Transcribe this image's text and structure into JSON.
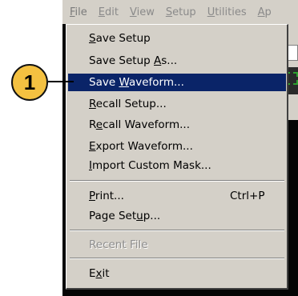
{
  "menubar": {
    "items": [
      {
        "label": "File",
        "mnemonic": "F",
        "rest": "ile"
      },
      {
        "label": "Edit",
        "mnemonic": "E",
        "rest": "dit"
      },
      {
        "label": "View",
        "mnemonic": "V",
        "rest": "iew"
      },
      {
        "label": "Setup",
        "mnemonic": "S",
        "rest": "etup"
      },
      {
        "label": "Utilities",
        "mnemonic": "U",
        "rest": "tilities"
      },
      {
        "label": "Ap",
        "mnemonic": "A",
        "rest": "p"
      }
    ]
  },
  "behind": {
    "box_char": "p"
  },
  "file_menu": {
    "items": [
      {
        "pre": "",
        "mn": "S",
        "post": "ave Setup"
      },
      {
        "pre": "Save Setup ",
        "mn": "A",
        "post": "s..."
      },
      {
        "pre": "Save ",
        "mn": "W",
        "post": "aveform..."
      },
      {
        "pre": "",
        "mn": "R",
        "post": "ecall Setup..."
      },
      {
        "pre": "R",
        "mn": "e",
        "post": "call Waveform..."
      },
      {
        "pre": "",
        "mn": "E",
        "post": "xport Waveform..."
      },
      {
        "pre": "",
        "mn": "I",
        "post": "mport Custom Mask..."
      },
      {
        "pre": "",
        "mn": "P",
        "post": "rint...",
        "shortcut": "Ctrl+P"
      },
      {
        "pre": "Page Set",
        "mn": "u",
        "post": "p..."
      },
      {
        "pre": "Recent File",
        "mn": "",
        "post": ""
      },
      {
        "pre": "E",
        "mn": "x",
        "post": "it"
      }
    ]
  },
  "callout": {
    "number": "1"
  },
  "colors": {
    "selection": "#0a2468",
    "menu_bg": "#d4d0c8",
    "callout": "#f4c141"
  }
}
